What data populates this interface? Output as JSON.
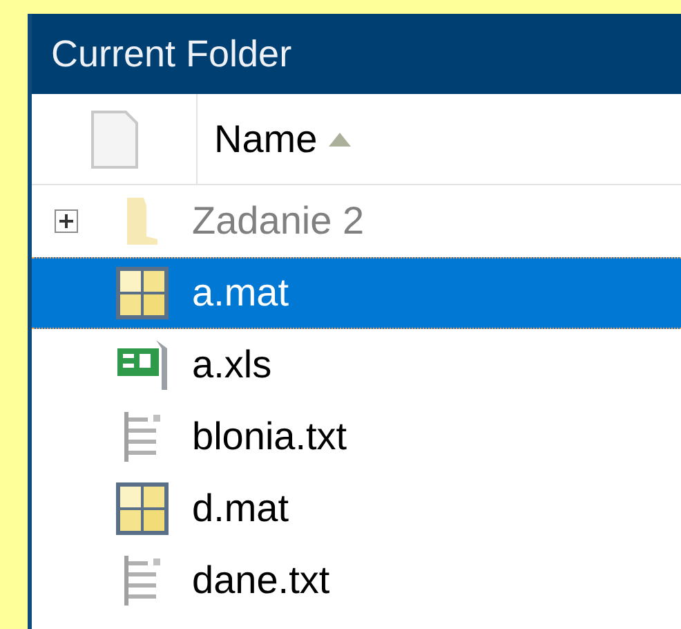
{
  "panel": {
    "title": "Current Folder"
  },
  "columns": [
    {
      "label": "Name",
      "sorted_ascending": true
    }
  ],
  "rows": [
    {
      "kind": "folder",
      "name": "Zadanie 2",
      "expanded": false,
      "selected": false,
      "dimmed": true
    },
    {
      "kind": "mat",
      "name": "a.mat",
      "selected": true,
      "dimmed": false
    },
    {
      "kind": "xls",
      "name": "a.xls",
      "selected": false,
      "dimmed": false
    },
    {
      "kind": "txt",
      "name": "blonia.txt",
      "selected": false,
      "dimmed": false
    },
    {
      "kind": "mat",
      "name": "d.mat",
      "selected": false,
      "dimmed": false
    },
    {
      "kind": "txt",
      "name": "dane.txt",
      "selected": false,
      "dimmed": false
    }
  ]
}
